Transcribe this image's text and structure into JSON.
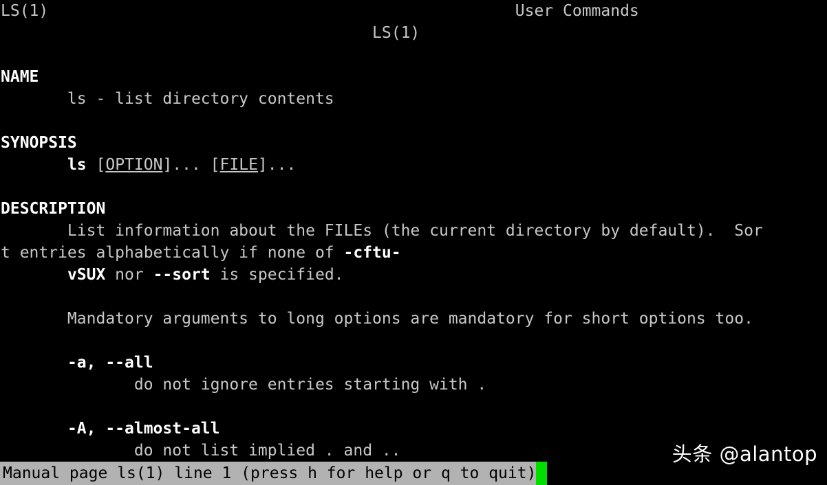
{
  "terminal": {
    "program": "man",
    "page_title_left": "LS(1)",
    "page_title_center": "User Commands",
    "page_title_right": "LS(1)",
    "lines": [
      {
        "id": "header-line-1",
        "segments": [
          {
            "text": "LS(1)",
            "style": "plain"
          },
          {
            "text": "                                                 ",
            "style": "plain"
          },
          {
            "text": "User Commands",
            "style": "plain"
          }
        ]
      },
      {
        "id": "header-line-2",
        "segments": [
          {
            "text": "                                       ",
            "style": "plain"
          },
          {
            "text": "LS(1)",
            "style": "plain"
          }
        ]
      },
      {
        "id": "blank-1",
        "segments": []
      },
      {
        "id": "section-name",
        "segments": [
          {
            "text": "NAME",
            "style": "head"
          }
        ]
      },
      {
        "id": "name-body",
        "segments": [
          {
            "text": "       ls - list directory contents",
            "style": "plain"
          }
        ]
      },
      {
        "id": "blank-2",
        "segments": []
      },
      {
        "id": "section-synopsis",
        "segments": [
          {
            "text": "SYNOPSIS",
            "style": "head"
          }
        ]
      },
      {
        "id": "synopsis-body",
        "segments": [
          {
            "text": "       ",
            "style": "plain"
          },
          {
            "text": "ls",
            "style": "bold"
          },
          {
            "text": " [",
            "style": "plain"
          },
          {
            "text": "OPTION",
            "style": "underline"
          },
          {
            "text": "]... [",
            "style": "plain"
          },
          {
            "text": "FILE",
            "style": "underline"
          },
          {
            "text": "]...",
            "style": "plain"
          }
        ]
      },
      {
        "id": "blank-3",
        "segments": []
      },
      {
        "id": "section-description",
        "segments": [
          {
            "text": "DESCRIPTION",
            "style": "head"
          }
        ]
      },
      {
        "id": "description-body-1",
        "segments": [
          {
            "text": "       List information about the FILEs (the current directory by default).  Sor",
            "style": "plain"
          }
        ]
      },
      {
        "id": "description-body-2",
        "segments": [
          {
            "text": "t entries alphabetically if none of ",
            "style": "plain"
          },
          {
            "text": "-cftu-",
            "style": "bold"
          }
        ]
      },
      {
        "id": "description-body-3",
        "segments": [
          {
            "text": "       ",
            "style": "plain"
          },
          {
            "text": "vSUX",
            "style": "bold"
          },
          {
            "text": " nor ",
            "style": "plain"
          },
          {
            "text": "--sort",
            "style": "bold"
          },
          {
            "text": " is specified.",
            "style": "plain"
          }
        ]
      },
      {
        "id": "blank-4",
        "segments": []
      },
      {
        "id": "mandatory-note",
        "segments": [
          {
            "text": "       Mandatory arguments to long options are mandatory for short options too.",
            "style": "plain"
          }
        ]
      },
      {
        "id": "blank-5",
        "segments": []
      },
      {
        "id": "option-a",
        "segments": [
          {
            "text": "       ",
            "style": "plain"
          },
          {
            "text": "-a, --all",
            "style": "bold"
          }
        ]
      },
      {
        "id": "option-a-desc",
        "segments": [
          {
            "text": "              do not ignore entries starting with .",
            "style": "plain"
          }
        ]
      },
      {
        "id": "blank-6",
        "segments": []
      },
      {
        "id": "option-A",
        "segments": [
          {
            "text": "       ",
            "style": "plain"
          },
          {
            "text": "-A, --almost-all",
            "style": "bold"
          }
        ]
      },
      {
        "id": "option-A-desc",
        "segments": [
          {
            "text": "              do not list implied . and ..",
            "style": "plain"
          }
        ]
      }
    ]
  },
  "statusbar": {
    "text": "Manual page ls(1) line 1 (press h for help or q to quit)",
    "cursor": " "
  },
  "watermark": {
    "text": "头条 @alantop"
  },
  "colors": {
    "background": "#000000",
    "foreground": "#c8c8c8",
    "bold": "#ffffff",
    "statusbar_background": "#b2b2b2",
    "statusbar_foreground": "#000000",
    "cursor": "#00e000"
  }
}
